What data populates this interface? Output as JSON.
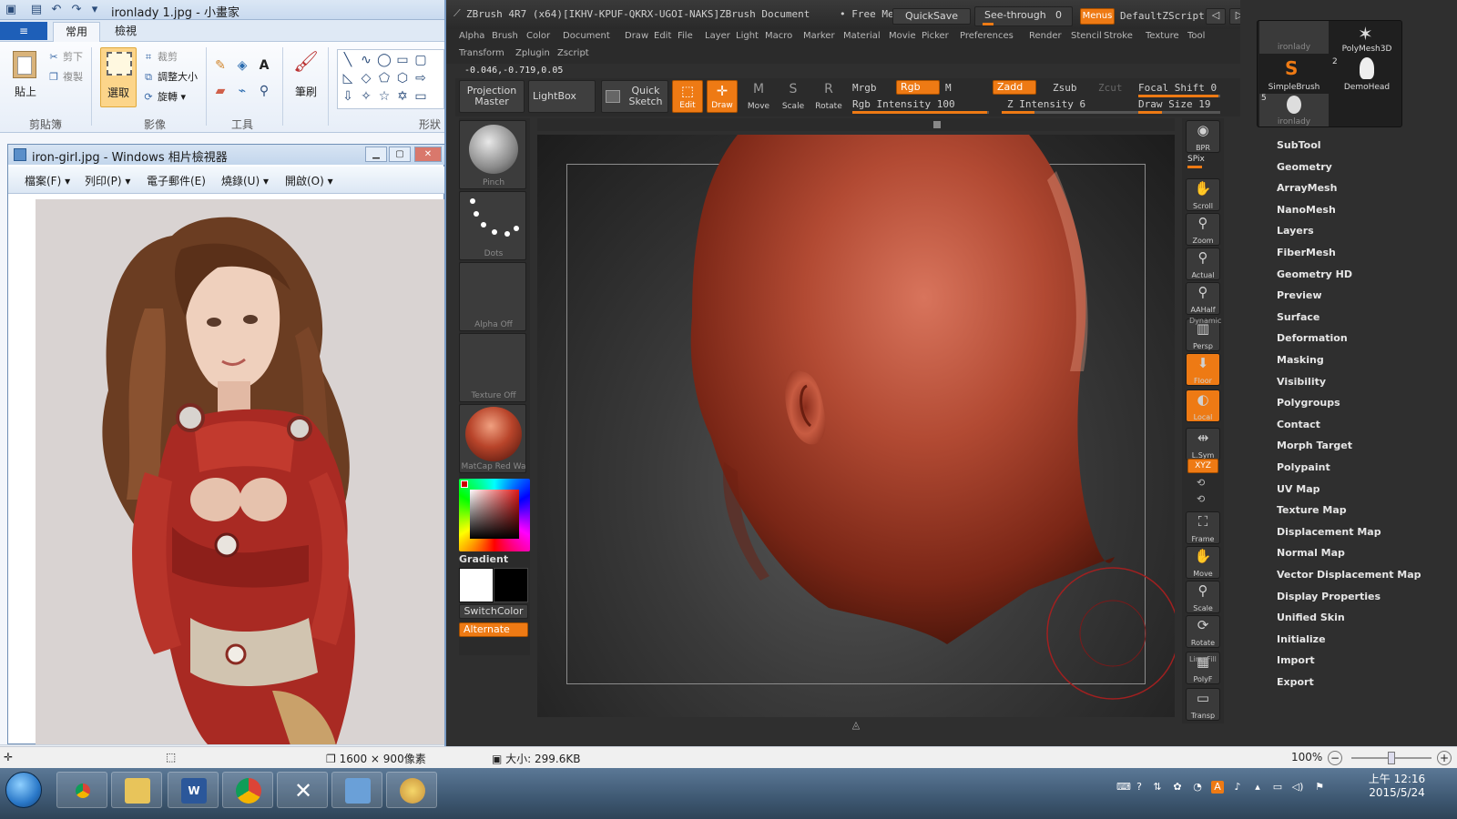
{
  "paint": {
    "title": "ironlady 1.jpg - 小畫家",
    "file_tab": "≡",
    "tabs": [
      "常用",
      "檢視"
    ],
    "clipboard": {
      "paste": "貼上",
      "cut": "剪下",
      "copy": "複製",
      "group": "剪貼簿"
    },
    "image": {
      "select": "選取",
      "crop": "裁剪",
      "resize": "調整大小",
      "rotate": "旋轉",
      "group": "影像"
    },
    "tools": {
      "group": "工具"
    },
    "brushes": {
      "label": "筆刷"
    },
    "shapes": {
      "group": "形狀"
    }
  },
  "viewer": {
    "title": "iron-girl.jpg - Windows 相片檢視器",
    "menu": [
      "檔案(F)",
      "列印(P)",
      "電子郵件(E)",
      "燒錄(U)",
      "開啟(O)"
    ]
  },
  "zbrush": {
    "title": "ZBrush 4R7 (x64)[IKHV-KPUF-QKRX-UGOI-NAKS]",
    "document": "ZBrush Document",
    "free_mem": "• Free Me",
    "quicksave": "QuickSave",
    "see_through": "See-through",
    "see_through_value": "0",
    "menus": "Menus",
    "default_zscript": "DefaultZScript",
    "menu_row1": [
      "Alpha",
      "Brush",
      "Color",
      "Document",
      "Draw",
      "Edit",
      "File",
      "Layer",
      "Light",
      "Macro",
      "Marker",
      "Material",
      "Movie",
      "Picker",
      "Preferences",
      "Render",
      "Stencil",
      "Stroke",
      "Texture",
      "Tool"
    ],
    "menu_row2": [
      "Transform",
      "Zplugin",
      "Zscript"
    ],
    "coords": "-0.046,-0.719,0.05",
    "top_shelf": {
      "projection_master": "Projection\nMaster",
      "lightbox": "LightBox",
      "quick_sketch": "Quick\nSketch",
      "edit": "Edit",
      "draw": "Draw",
      "move": "Move",
      "scale": "Scale",
      "rotate": "Rotate",
      "mrgb": "Mrgb",
      "rgb": "Rgb",
      "m": "M",
      "zadd": "Zadd",
      "zsub": "Zsub",
      "zcut": "Zcut",
      "rgb_intensity": "Rgb Intensity 100",
      "z_intensity": "Z Intensity 6",
      "focal_shift": "Focal Shift 0",
      "draw_size": "Draw Size 19"
    },
    "left_shelf": {
      "brush": "Pinch",
      "stroke": "Dots",
      "alpha": "Alpha Off",
      "texture": "Texture Off",
      "material": "MatCap Red Wa",
      "gradient": "Gradient",
      "switch_color": "SwitchColor",
      "alternate": "Alternate"
    },
    "right_shelf": [
      "BPR",
      "SPix",
      "Scroll",
      "Zoom",
      "Actual",
      "AAHalf",
      "Persp",
      "Floor",
      "Local",
      "L.Sym",
      "Frame",
      "Move",
      "Scale",
      "Rotate",
      "PolyF",
      "Transp"
    ],
    "right_shelf_extra": {
      "dynamic": "Dynamic",
      "line_fill": "Line Fill",
      "xyz": "XYZ"
    },
    "subtools": {
      "items": [
        "ironlady",
        "PolyMesh3D",
        "SimpleBrush",
        "DemoHead",
        "ironlady"
      ],
      "counts": [
        "2",
        "5"
      ]
    },
    "tool_palette": [
      "SubTool",
      "Geometry",
      "ArrayMesh",
      "NanoMesh",
      "Layers",
      "FiberMesh",
      "Geometry HD",
      "Preview",
      "Surface",
      "Deformation",
      "Masking",
      "Visibility",
      "Polygroups",
      "Contact",
      "Morph Target",
      "Polypaint",
      "UV Map",
      "Texture Map",
      "Displacement Map",
      "Normal Map",
      "Vector Displacement Map",
      "Display Properties",
      "Unified Skin",
      "Initialize",
      "Import",
      "Export"
    ]
  },
  "status": {
    "dimensions": "1600 × 900像素",
    "size": "大小: 299.6KB",
    "zoom": "100%"
  },
  "taskbar": {
    "time": "上午 12:16",
    "date": "2015/5/24"
  },
  "colors": {
    "zbrush_orange": "#ee7a14",
    "head_skin": "#a8402c"
  }
}
